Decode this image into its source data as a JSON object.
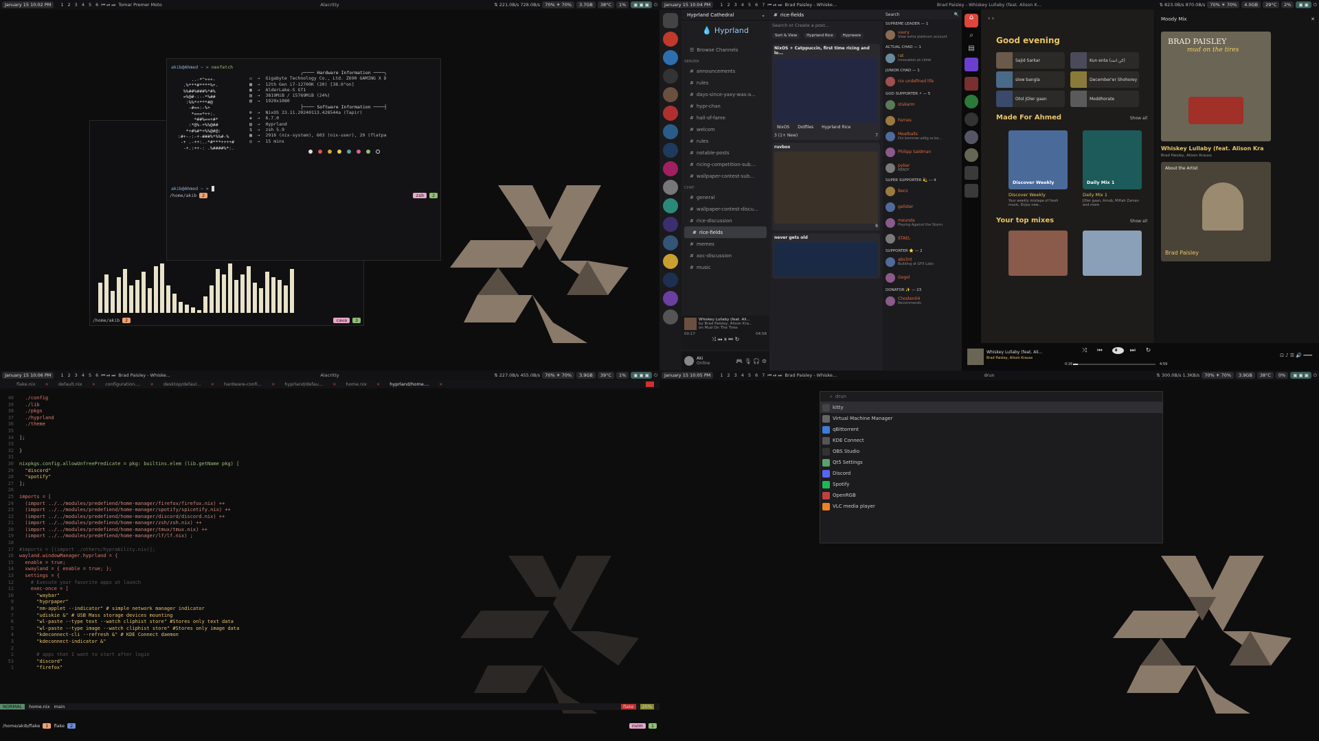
{
  "bars": {
    "q1": {
      "date": "January 15",
      "time": "10:02 PM",
      "window": "Tomar Premer Moto",
      "title": "Alacritty",
      "net": "221.0B/s",
      "net2": "728.0B/s",
      "vol": "70%",
      "bright": "70%",
      "mem": "3.7GB",
      "temp": "38°C",
      "cpu": "1%"
    },
    "q2": {
      "date": "January 15",
      "time": "10:04 PM",
      "window": "Brad Paisley - Whiske...",
      "title": "Brad Paisley - Whiskey Lullaby (feat. Alison K...",
      "net": "823.0B/s",
      "net2": "870.0B/s",
      "vol": "70%",
      "bright": "70%",
      "mem": "4.0GB",
      "temp": "29°C",
      "cpu": "2%"
    },
    "q3": {
      "date": "January 15",
      "time": "10:06 PM",
      "window": "Brad Paisley - Whiske...",
      "title": "Alacritty",
      "net": "227.0B/s",
      "net2": "455.0B/s",
      "vol": "70%",
      "bright": "70%",
      "mem": "3.9GB",
      "temp": "39°C",
      "cpu": "1%"
    },
    "q4": {
      "date": "January 15",
      "time": "10:05 PM",
      "window": "Brad Paisley - Whiske...",
      "title": "drun",
      "net": "300.0B/s",
      "net2": "1.3KB/s",
      "vol": "70%",
      "bright": "70%",
      "mem": "3.9GB",
      "temp": "38°C",
      "cpu": "0%"
    },
    "workspaces": [
      "1",
      "2",
      "3",
      "4",
      "5",
      "6"
    ],
    "workspaces7": [
      "1",
      "2",
      "3",
      "4",
      "5",
      "6",
      "7"
    ]
  },
  "neofetch": {
    "prompt": "akib@Ahmed ~ >",
    "cmd": "neofetch",
    "hw_title": "Hardware Information",
    "hw": [
      "Gigabyte Technology Co., Ltd. Z690 GAMING X D",
      "12th Gen i7-12700K (20) [38.0°on]",
      "AlderLake-S GT1",
      "3819MiB / 15769MiB (24%)",
      "1920x1080"
    ],
    "sw_title": "Software Information",
    "sw": [
      "NixOS 23.11.20240113.428544a (Tapir)",
      "6.7.0",
      "Hyprland",
      "zsh 5.9",
      "2916 (nix-system), 603 (nix-user), 29 (flatpa",
      "15 mins"
    ],
    "prompt2": "akib@Ahmed ~ >",
    "path": "/home/akib",
    "num": "2",
    "shell": "zsh",
    "shellnum": "2"
  },
  "cava": {
    "path": "/home/akib",
    "num": "2",
    "app": "cava",
    "appnum": "3",
    "levels": [
      0.55,
      0.7,
      0.4,
      0.65,
      0.8,
      0.5,
      0.6,
      0.75,
      0.45,
      0.85,
      0.9,
      0.5,
      0.35,
      0.2,
      0.15,
      0.1,
      0.05,
      0.3,
      0.5,
      0.8,
      0.7,
      0.9,
      0.6,
      0.7,
      0.85,
      0.55,
      0.45,
      0.75,
      0.65,
      0.6,
      0.5,
      0.8
    ]
  },
  "discord": {
    "server": "Hyprland Cathedral",
    "brand": "Hyprland",
    "browse": "Browse Channels",
    "cat_server": "SERVER",
    "cat_chat": "CHAT",
    "channels": [
      "announcements",
      "rules",
      "days-since-yaxy-was-a...",
      "hypr-chan",
      "hall-of-fame",
      "welcom",
      "rules",
      "notable-posts",
      "ricing-competition-sub...",
      "wallpaper-contest-sub..."
    ],
    "chat": [
      "general",
      "wallpaper-contest-discu...",
      "rice-discussion",
      "rice-fields",
      "memes",
      "aoc-discussion",
      "music"
    ],
    "channel": "rice-fields",
    "search": "Search",
    "create": "Search or Create a post...",
    "sort": "Sort & View",
    "tag1": "Hyprland Rice",
    "tag2": "Hyprware",
    "post1": "NixOS + Catppuccin, first time ricing and lo...",
    "post1tags": [
      "NixOS",
      "Dotfiles",
      "Hyprland Rice"
    ],
    "post1meta": "3 (1+ New)",
    "post1count": "7",
    "post2": "ruvbox",
    "post2count": "8",
    "post3": "never gets old",
    "np_title": "Whiskey Lullaby (feat. Ali...",
    "np_artist": "by Brad Paisley, Alison Kra...",
    "np_album": "on Mud On The Tires",
    "np_t0": "00:17",
    "np_t1": "04:58",
    "user": "Aki",
    "user_status": "Online",
    "roles": [
      {
        "r": "SUPREME LEADER — 1",
        "m": [
          {
            "n": "vaxry",
            "c": "#e36b3b",
            "s": "View extra platinum account"
          }
        ]
      },
      {
        "r": "ACTUAL CHAD — 1",
        "m": [
          {
            "n": "rat",
            "c": "#c98b3a",
            "s": "Innovation pt climb"
          }
        ]
      },
      {
        "r": "JUNIOR CHAD — 1",
        "m": [
          {
            "n": "nix undefined life",
            "c": "#e36b3b",
            "s": ""
          }
        ]
      },
      {
        "r": "GOD SUPPORTER ⚡ — 5",
        "m": [
          {
            "n": "stukarm",
            "c": "#e36b3b",
            "s": ""
          },
          {
            "n": "Fernes",
            "c": "#e36b3b",
            "s": ""
          },
          {
            "n": "Meatballs",
            "c": "#e36b3b",
            "s": "Dni bommer-aldig ss be..."
          },
          {
            "n": "Philipp Saldman",
            "c": "#e36b3b",
            "s": ""
          },
          {
            "n": "pybar",
            "c": "#e36b3b",
            "s": "READY"
          }
        ]
      },
      {
        "r": "SUPER SUPPORTER 💫 — 4",
        "m": [
          {
            "n": "Benz",
            "c": "#e36b3b",
            "s": ""
          },
          {
            "n": "galister",
            "c": "#e36b3b",
            "s": ""
          },
          {
            "n": "meunda",
            "c": "#e36b3b",
            "s": "Playing Against the Storm"
          },
          {
            "n": "STAEL",
            "c": "#e36b3b",
            "s": ""
          }
        ]
      },
      {
        "r": "SUPPORTER ⭐ — 2",
        "m": [
          {
            "n": "abs3nt",
            "c": "#e36b3b",
            "s": "Building at GFX Labs"
          },
          {
            "n": "Gogol",
            "c": "#e36b3b",
            "s": ""
          }
        ]
      },
      {
        "r": "DONATOR ✨ — 23",
        "m": [
          {
            "n": "Chosten04",
            "c": "#e36b3b",
            "s": "Recommends"
          }
        ]
      }
    ]
  },
  "spotify": {
    "greet": "Good evening",
    "tiles": [
      "Sajid Sarkar",
      "Kun enta (كن انت)",
      "slow bangla",
      "December'er Shohorey",
      "Otol JOler gaan",
      "Moddhorate"
    ],
    "made_title": "Made For Ahmed",
    "show_all": "Show all",
    "mixes": [
      {
        "t": "Discover Weekly",
        "cover": "Discover Weekly",
        "d": "Your weekly mixtape of fresh music. Enjoy new..."
      },
      {
        "t": "Daily Mix 1",
        "cover": "Daily Mix 1",
        "d": "JOler gaan, Arnob, Miftah Zaman and more"
      }
    ],
    "top_title": "Your top mixes",
    "panel_title": "Moody Mix",
    "album_artist": "BRAD PAISLEY",
    "album_name": "mud on the tires",
    "song": "Whiskey Lullaby (feat. Alison Kra",
    "artists": "Brad Paisley, Alison Krauss",
    "about": "About the Artist",
    "artist": "Brad Paisley",
    "np_title": "Whiskey Lullaby (feat. Ali...",
    "np_artists": "Brad Paisley, Alison Krauss",
    "t0": "0:16",
    "t1": "4:59",
    "progress": 0.06
  },
  "nvim": {
    "tabs": [
      "flake.nix",
      "default.nix",
      "configuration....",
      "desktop/defaul...",
      "hardware-confi...",
      "hyprland/defau...",
      "home.nix",
      "hyprland/home...."
    ],
    "lines": [
      {
        "n": "40",
        "t": "  ./config",
        "c": "#e07b6a"
      },
      {
        "n": "39",
        "t": "  ./lib",
        "c": "#e07b6a"
      },
      {
        "n": "38",
        "t": "  ./pkgs",
        "c": "#e07b6a"
      },
      {
        "n": "37",
        "t": "  ./hyprland",
        "c": "#e07b6a"
      },
      {
        "n": "36",
        "t": "  ./theme",
        "c": "#e07b6a"
      },
      {
        "n": "35",
        "t": "",
        "c": "#bbb"
      },
      {
        "n": "34",
        "t": "];",
        "c": "#bbb"
      },
      {
        "n": "33",
        "t": "",
        "c": "#bbb"
      },
      {
        "n": "32",
        "t": "}",
        "c": "#bbb"
      },
      {
        "n": "31",
        "t": "",
        "c": "#bbb"
      },
      {
        "n": "30",
        "t": "nixpkgs.config.allowUnfreePredicate = pkg: builtins.elem (lib.getName pkg) [",
        "c": "#9ec07a"
      },
      {
        "n": "29",
        "t": "  \"discord\"",
        "c": "#e9c46a"
      },
      {
        "n": "28",
        "t": "  \"spotify\"",
        "c": "#e9c46a"
      },
      {
        "n": "27",
        "t": "];",
        "c": "#bbb"
      },
      {
        "n": "26",
        "t": "",
        "c": "#bbb"
      },
      {
        "n": "25",
        "t": "imports = [",
        "c": "#e07b6a"
      },
      {
        "n": "24",
        "t": "  (import ../../modules/predefiend/home-manager/firefox/firefox.nix) ++",
        "c": "#d08a7a"
      },
      {
        "n": "23",
        "t": "  (import ../../modules/predefiend/home-manager/spotify/spicetify.nix) ++",
        "c": "#d08a7a"
      },
      {
        "n": "22",
        "t": "  (import ../../modules/predefiend/home-manager/discord/discord.nix) ++",
        "c": "#d08a7a"
      },
      {
        "n": "21",
        "t": "  (import ../../modules/predefiend/home-manager/zsh/zsh.nix) ++",
        "c": "#d08a7a"
      },
      {
        "n": "20",
        "t": "  (import ../../modules/predefiend/home-manager/tmux/tmux.nix) ++",
        "c": "#d08a7a"
      },
      {
        "n": "19",
        "t": "  (import ../../modules/predefiend/home-manager/lf/lf.nix) ;",
        "c": "#d08a7a"
      },
      {
        "n": "18",
        "t": "",
        "c": "#bbb"
      },
      {
        "n": "17",
        "t": "#imports = [(import ./others/hyprability.nix)];",
        "c": "#555"
      },
      {
        "n": "16",
        "t": "wayland.windowManager.hyprland = {",
        "c": "#e07b6a"
      },
      {
        "n": "15",
        "t": "  enable = true;",
        "c": "#e07b6a"
      },
      {
        "n": "14",
        "t": "  xwayland = { enable = true; };",
        "c": "#e07b6a"
      },
      {
        "n": "13",
        "t": "  settings = {",
        "c": "#e07b6a"
      },
      {
        "n": "12",
        "t": "    # Execute your favorite apps at launch",
        "c": "#555"
      },
      {
        "n": "11",
        "t": "    exec-once = [",
        "c": "#e07b6a"
      },
      {
        "n": "10",
        "t": "      \"waybar\"",
        "c": "#e9c46a"
      },
      {
        "n": "9",
        "t": "      \"hyprpaper\"",
        "c": "#e9c46a"
      },
      {
        "n": "8",
        "t": "      \"nm-applet --indicator\" # simple network manager indicator",
        "c": "#e9c46a"
      },
      {
        "n": "7",
        "t": "      \"udiskie &\" # USB Mass storage devices mounting",
        "c": "#e9c46a"
      },
      {
        "n": "6",
        "t": "      \"wl-paste --type text --watch cliphist store\" #Stores only text data",
        "c": "#e9c46a"
      },
      {
        "n": "5",
        "t": "      \"wl-paste --type image --watch cliphist store\" #Stores only image data",
        "c": "#e9c46a"
      },
      {
        "n": "4",
        "t": "      \"kdeconnect-cli --refresh &\" # KDE Connect daemon",
        "c": "#e9c46a"
      },
      {
        "n": "3",
        "t": "      \"kdeconnect-indicator &\"",
        "c": "#e9c46a"
      },
      {
        "n": "2",
        "t": "",
        "c": "#bbb"
      },
      {
        "n": "1",
        "t": "      # apps that I want to start after login",
        "c": "#555"
      },
      {
        "n": "53",
        "t": "      \"discord\"",
        "c": "#e9c46a"
      },
      {
        "n": "1",
        "t": "      \"firefox\"",
        "c": "#e9c46a"
      }
    ],
    "mode": "NORMAL",
    "file": "home.nix",
    "branch": "main",
    "flake": "flake",
    "pct": "25%",
    "path": "/home/akib/flake",
    "num1": "1",
    "label": "flake",
    "num2": "2",
    "app": "nvim",
    "appnum": "1"
  },
  "launcher": {
    "placeholder": "drun",
    "items": [
      {
        "n": "kitty",
        "c": "#444"
      },
      {
        "n": "Virtual Machine Manager",
        "c": "#666"
      },
      {
        "n": "qBittorrent",
        "c": "#3b7dd8"
      },
      {
        "n": "KDE Connect",
        "c": "#555"
      },
      {
        "n": "OBS Studio",
        "c": "#333"
      },
      {
        "n": "Qt5 Settings",
        "c": "#5aa06a"
      },
      {
        "n": "Discord",
        "c": "#5865f2"
      },
      {
        "n": "Spotify",
        "c": "#1db954"
      },
      {
        "n": "OpenRGB",
        "c": "#c04040"
      },
      {
        "n": "VLC media player",
        "c": "#f08020"
      }
    ]
  }
}
